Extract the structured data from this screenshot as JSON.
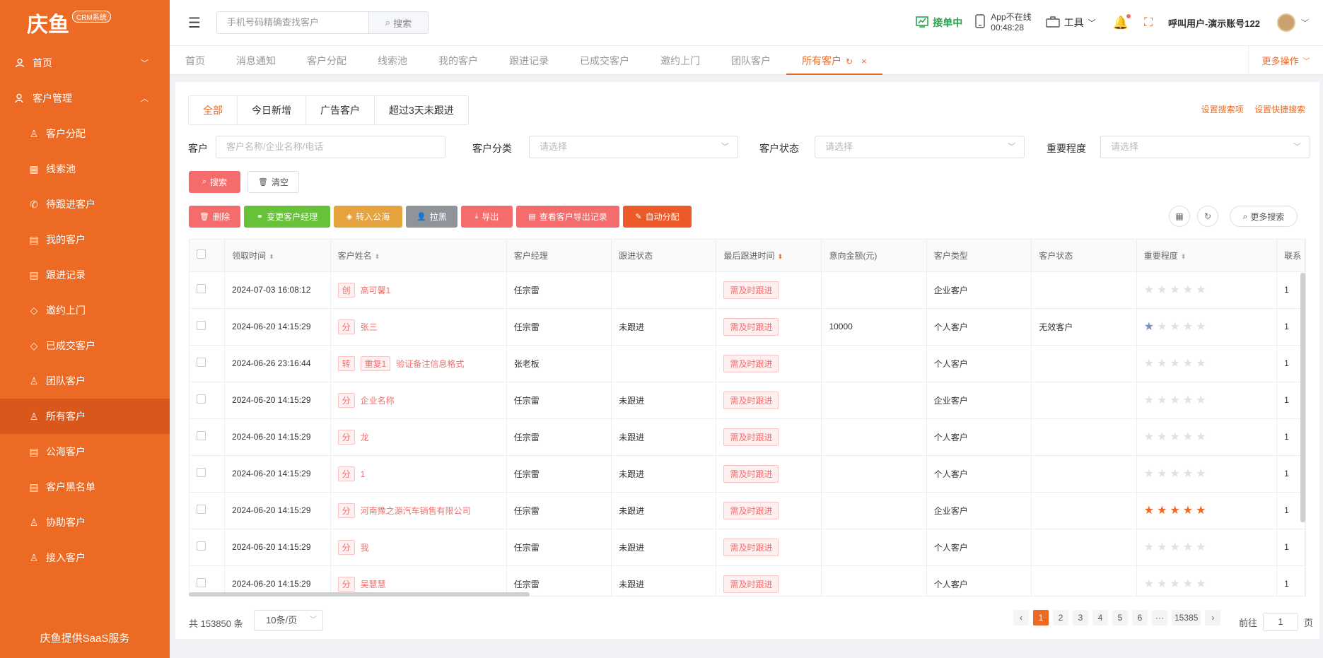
{
  "app": {
    "logo_text": "庆鱼",
    "logo_badge": "CRM系统",
    "footer": "庆鱼提供SaaS服务"
  },
  "sidebar": {
    "home": "首页",
    "customer_mgmt": "客户管理",
    "items": [
      {
        "label": "客户分配",
        "icon": "user-icon"
      },
      {
        "label": "线索池",
        "icon": "table-icon"
      },
      {
        "label": "待跟进客户",
        "icon": "phone-icon"
      },
      {
        "label": "我的客户",
        "icon": "document-icon"
      },
      {
        "label": "跟进记录",
        "icon": "document-icon"
      },
      {
        "label": "邀约上门",
        "icon": "tag-icon"
      },
      {
        "label": "已成交客户",
        "icon": "tag-icon"
      },
      {
        "label": "团队客户",
        "icon": "user-icon"
      },
      {
        "label": "所有客户",
        "icon": "user-icon"
      },
      {
        "label": "公海客户",
        "icon": "document-icon"
      },
      {
        "label": "客户黑名单",
        "icon": "document-icon"
      },
      {
        "label": "协助客户",
        "icon": "user-icon"
      },
      {
        "label": "接入客户",
        "icon": "user-icon"
      }
    ]
  },
  "topbar": {
    "search_placeholder": "手机号码精确查找客户",
    "search_btn": "搜索",
    "online_status": "接单中",
    "app_status_line1": "App不在线",
    "app_status_line2": "00:48:28",
    "tools": "工具",
    "username": "呼叫用户-演示账号122"
  },
  "tabs": [
    "首页",
    "消息通知",
    "客户分配",
    "线索池",
    "我的客户",
    "跟进记录",
    "已成交客户",
    "邀约上门",
    "团队客户",
    "所有客户"
  ],
  "more_ops": "更多操作",
  "filter_tabs": [
    "全部",
    "今日新增",
    "广告客户",
    "超过3天未跟进"
  ],
  "links": {
    "set_search": "设置搜索项",
    "set_quick": "设置快捷搜索"
  },
  "form": {
    "customer_label": "客户",
    "customer_placeholder": "客户名称/企业名称/电话",
    "category_label": "客户分类",
    "status_label": "客户状态",
    "importance_label": "重要程度",
    "select_placeholder": "请选择"
  },
  "buttons": {
    "search": "搜索",
    "clear": "清空",
    "delete": "删除",
    "change_manager": "变更客户经理",
    "to_public": "转入公海",
    "blacklist": "拉黑",
    "export": "导出",
    "export_log": "查看客户导出记录",
    "auto_assign": "自动分配",
    "more_search": "更多搜索"
  },
  "colors": {
    "primary": "#ec6a24",
    "danger": "#f56c6c",
    "success": "#67c23a",
    "warning": "#e6a23c",
    "info": "#909399"
  },
  "table": {
    "headers": [
      "领取时间",
      "客户姓名",
      "客户经理",
      "跟进状态",
      "最后跟进时间",
      "意向金额(元)",
      "客户类型",
      "客户状态",
      "重要程度",
      "联系"
    ],
    "rows": [
      {
        "time": "2024-07-03 16:08:12",
        "tags": [
          "创"
        ],
        "name": "高可馨1",
        "manager": "任宗雷",
        "follow": "",
        "last": "需及时跟进",
        "amount": "",
        "type": "企业客户",
        "status": "",
        "stars": 0,
        "contact": "1"
      },
      {
        "time": "2024-06-20 14:15:29",
        "tags": [
          "分"
        ],
        "name": "张三",
        "manager": "任宗雷",
        "follow": "未跟进",
        "last": "需及时跟进",
        "amount": "10000",
        "type": "个人客户",
        "status": "无效客户",
        "stars": 1,
        "contact": "1"
      },
      {
        "time": "2024-06-26 23:16:44",
        "tags": [
          "转",
          "重复1"
        ],
        "name": "验证备注信息格式",
        "manager": "张老板",
        "follow": "",
        "last": "需及时跟进",
        "amount": "",
        "type": "个人客户",
        "status": "",
        "stars": 0,
        "contact": "1"
      },
      {
        "time": "2024-06-20 14:15:29",
        "tags": [
          "分"
        ],
        "name": "企业名称",
        "manager": "任宗雷",
        "follow": "未跟进",
        "last": "需及时跟进",
        "amount": "",
        "type": "企业客户",
        "status": "",
        "stars": 0,
        "contact": "1"
      },
      {
        "time": "2024-06-20 14:15:29",
        "tags": [
          "分"
        ],
        "name": "龙",
        "manager": "任宗雷",
        "follow": "未跟进",
        "last": "需及时跟进",
        "amount": "",
        "type": "个人客户",
        "status": "",
        "stars": 0,
        "contact": "1"
      },
      {
        "time": "2024-06-20 14:15:29",
        "tags": [
          "分"
        ],
        "name": "1",
        "manager": "任宗雷",
        "follow": "未跟进",
        "last": "需及时跟进",
        "amount": "",
        "type": "个人客户",
        "status": "",
        "stars": 0,
        "contact": "1"
      },
      {
        "time": "2024-06-20 14:15:29",
        "tags": [
          "分"
        ],
        "name": "河南豫之源汽车销售有限公司",
        "manager": "任宗雷",
        "follow": "未跟进",
        "last": "需及时跟进",
        "amount": "",
        "type": "企业客户",
        "status": "",
        "stars": 5,
        "contact": "1"
      },
      {
        "time": "2024-06-20 14:15:29",
        "tags": [
          "分"
        ],
        "name": "我",
        "manager": "任宗雷",
        "follow": "未跟进",
        "last": "需及时跟进",
        "amount": "",
        "type": "个人客户",
        "status": "",
        "stars": 0,
        "contact": "1"
      },
      {
        "time": "2024-06-20 14:15:29",
        "tags": [
          "分"
        ],
        "name": "吴慧慧",
        "manager": "任宗雷",
        "follow": "未跟进",
        "last": "需及时跟进",
        "amount": "",
        "type": "个人客户",
        "status": "",
        "stars": 0,
        "contact": "1"
      }
    ]
  },
  "pagination": {
    "total": "共 153850 条",
    "page_size": "10条/页",
    "pages": [
      "1",
      "2",
      "3",
      "4",
      "5",
      "6",
      "···",
      "15385"
    ],
    "current": "1",
    "goto_prefix": "前往",
    "goto_value": "1",
    "goto_suffix": "页"
  }
}
